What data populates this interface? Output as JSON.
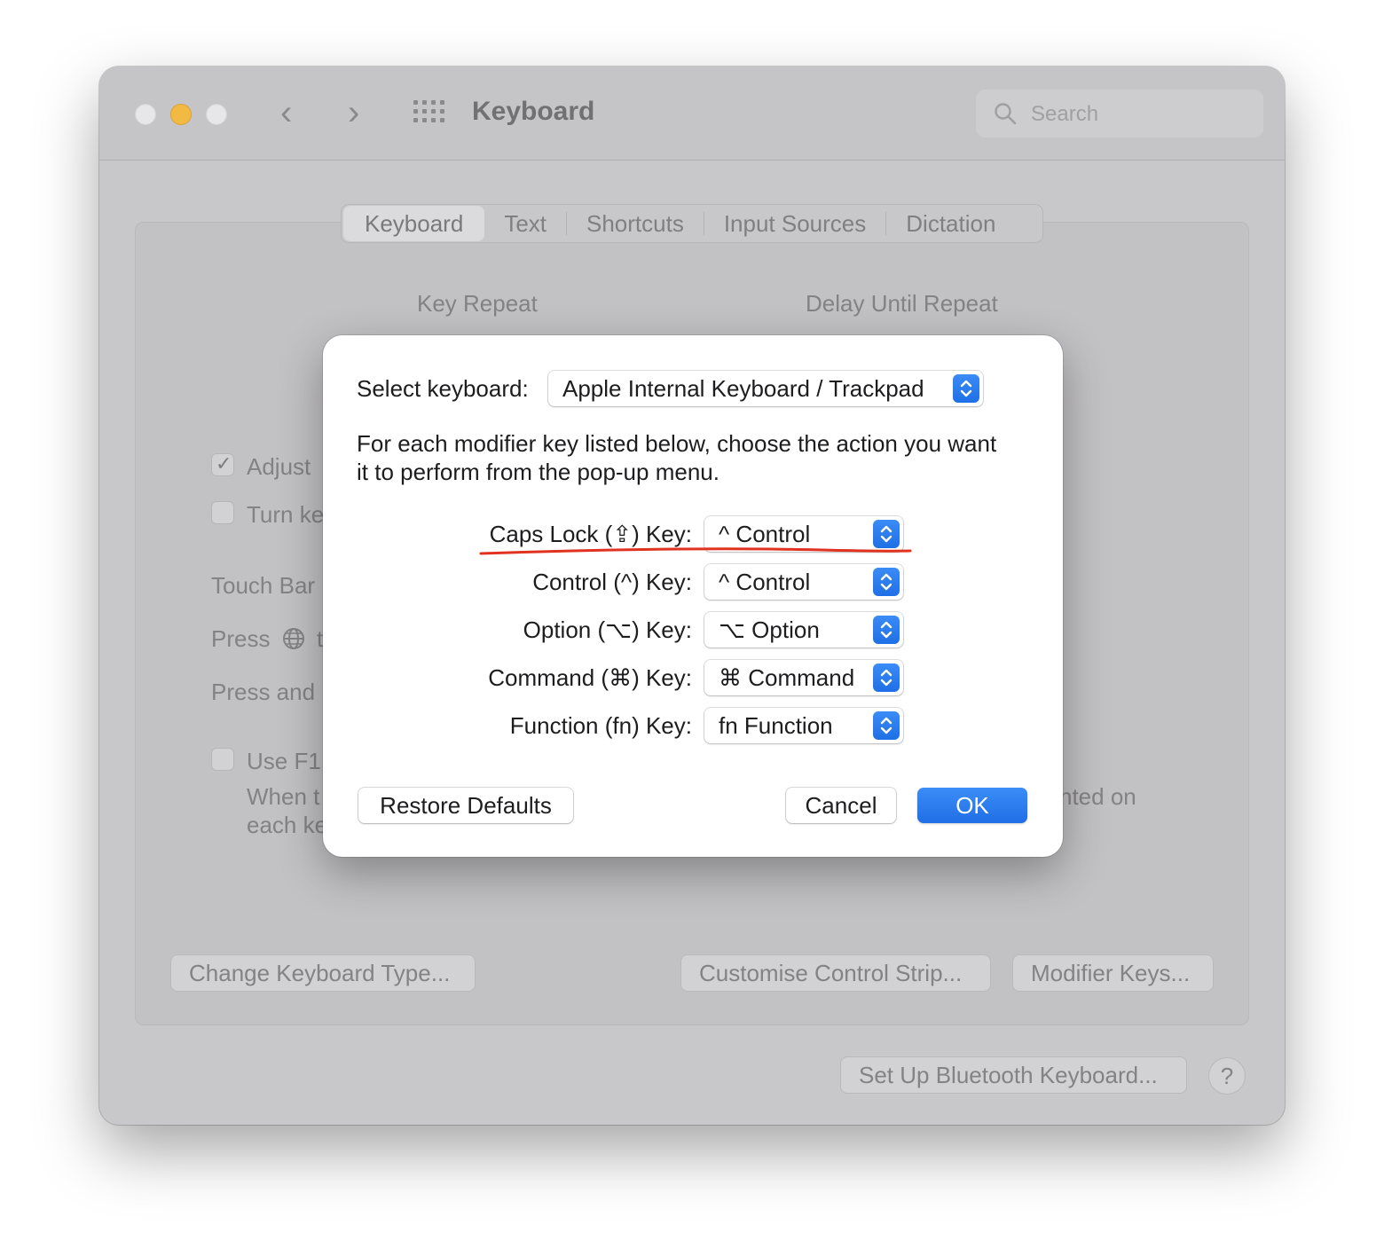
{
  "window": {
    "title": "Keyboard",
    "search_placeholder": "Search",
    "nav_back": "‹",
    "nav_forward": "›"
  },
  "tabs": [
    {
      "label": "Keyboard",
      "active": true
    },
    {
      "label": "Text",
      "active": false
    },
    {
      "label": "Shortcuts",
      "active": false
    },
    {
      "label": "Input Sources",
      "active": false
    },
    {
      "label": "Dictation",
      "active": false
    }
  ],
  "background": {
    "key_repeat": "Key Repeat",
    "delay_until_repeat": "Delay Until Repeat",
    "adjust_partial": "Adjust",
    "adjust_checked": true,
    "turn_partial": "Turn ke",
    "touch_bar_partial": "Touch Bar",
    "press_globe_partial": "Press",
    "press_globe_tail": "t",
    "press_and_partial": "Press and",
    "use_f1_partial": "Use F1,",
    "when_partial": "When t",
    "each_partial": "each ke",
    "printed_on_partial": "nted on",
    "change_keyboard_type": "Change Keyboard Type...",
    "customise_control_strip": "Customise Control Strip...",
    "modifier_keys": "Modifier Keys...",
    "bluetooth_setup": "Set Up Bluetooth Keyboard...",
    "help": "?"
  },
  "dialog": {
    "select_label": "Select keyboard:",
    "select_value": "Apple Internal Keyboard / Trackpad",
    "description": "For each modifier key listed below, choose the action you want it to perform from the pop-up menu.",
    "rows": [
      {
        "label": "Caps Lock (⇪) Key:",
        "value": "^ Control"
      },
      {
        "label": "Control (^) Key:",
        "value": "^ Control"
      },
      {
        "label": "Option (⌥) Key:",
        "value": "⌥ Option"
      },
      {
        "label": "Command (⌘) Key:",
        "value": "⌘ Command"
      },
      {
        "label": "Function (fn) Key:",
        "value": "fn Function"
      }
    ],
    "restore_defaults": "Restore Defaults",
    "cancel": "Cancel",
    "ok": "OK"
  },
  "colors": {
    "accent_blue": "#1f6fe6",
    "annotation_red": "#e0321f",
    "minimize_yellow": "#f2b943"
  }
}
